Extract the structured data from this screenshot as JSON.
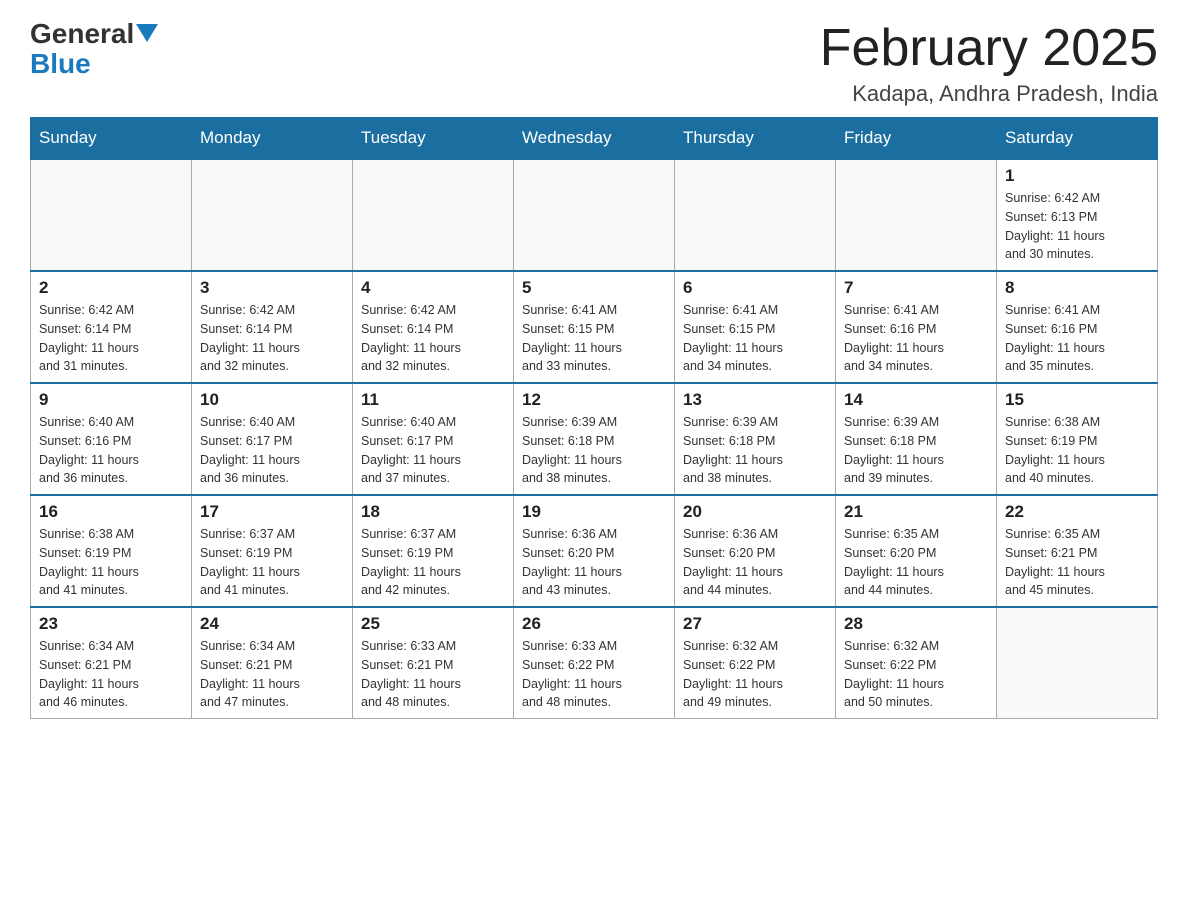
{
  "logo": {
    "general": "General",
    "blue": "Blue"
  },
  "header": {
    "title": "February 2025",
    "location": "Kadapa, Andhra Pradesh, India"
  },
  "days_of_week": [
    "Sunday",
    "Monday",
    "Tuesday",
    "Wednesday",
    "Thursday",
    "Friday",
    "Saturday"
  ],
  "weeks": [
    [
      {
        "date": "",
        "info": ""
      },
      {
        "date": "",
        "info": ""
      },
      {
        "date": "",
        "info": ""
      },
      {
        "date": "",
        "info": ""
      },
      {
        "date": "",
        "info": ""
      },
      {
        "date": "",
        "info": ""
      },
      {
        "date": "1",
        "info": "Sunrise: 6:42 AM\nSunset: 6:13 PM\nDaylight: 11 hours\nand 30 minutes."
      }
    ],
    [
      {
        "date": "2",
        "info": "Sunrise: 6:42 AM\nSunset: 6:14 PM\nDaylight: 11 hours\nand 31 minutes."
      },
      {
        "date": "3",
        "info": "Sunrise: 6:42 AM\nSunset: 6:14 PM\nDaylight: 11 hours\nand 32 minutes."
      },
      {
        "date": "4",
        "info": "Sunrise: 6:42 AM\nSunset: 6:14 PM\nDaylight: 11 hours\nand 32 minutes."
      },
      {
        "date": "5",
        "info": "Sunrise: 6:41 AM\nSunset: 6:15 PM\nDaylight: 11 hours\nand 33 minutes."
      },
      {
        "date": "6",
        "info": "Sunrise: 6:41 AM\nSunset: 6:15 PM\nDaylight: 11 hours\nand 34 minutes."
      },
      {
        "date": "7",
        "info": "Sunrise: 6:41 AM\nSunset: 6:16 PM\nDaylight: 11 hours\nand 34 minutes."
      },
      {
        "date": "8",
        "info": "Sunrise: 6:41 AM\nSunset: 6:16 PM\nDaylight: 11 hours\nand 35 minutes."
      }
    ],
    [
      {
        "date": "9",
        "info": "Sunrise: 6:40 AM\nSunset: 6:16 PM\nDaylight: 11 hours\nand 36 minutes."
      },
      {
        "date": "10",
        "info": "Sunrise: 6:40 AM\nSunset: 6:17 PM\nDaylight: 11 hours\nand 36 minutes."
      },
      {
        "date": "11",
        "info": "Sunrise: 6:40 AM\nSunset: 6:17 PM\nDaylight: 11 hours\nand 37 minutes."
      },
      {
        "date": "12",
        "info": "Sunrise: 6:39 AM\nSunset: 6:18 PM\nDaylight: 11 hours\nand 38 minutes."
      },
      {
        "date": "13",
        "info": "Sunrise: 6:39 AM\nSunset: 6:18 PM\nDaylight: 11 hours\nand 38 minutes."
      },
      {
        "date": "14",
        "info": "Sunrise: 6:39 AM\nSunset: 6:18 PM\nDaylight: 11 hours\nand 39 minutes."
      },
      {
        "date": "15",
        "info": "Sunrise: 6:38 AM\nSunset: 6:19 PM\nDaylight: 11 hours\nand 40 minutes."
      }
    ],
    [
      {
        "date": "16",
        "info": "Sunrise: 6:38 AM\nSunset: 6:19 PM\nDaylight: 11 hours\nand 41 minutes."
      },
      {
        "date": "17",
        "info": "Sunrise: 6:37 AM\nSunset: 6:19 PM\nDaylight: 11 hours\nand 41 minutes."
      },
      {
        "date": "18",
        "info": "Sunrise: 6:37 AM\nSunset: 6:19 PM\nDaylight: 11 hours\nand 42 minutes."
      },
      {
        "date": "19",
        "info": "Sunrise: 6:36 AM\nSunset: 6:20 PM\nDaylight: 11 hours\nand 43 minutes."
      },
      {
        "date": "20",
        "info": "Sunrise: 6:36 AM\nSunset: 6:20 PM\nDaylight: 11 hours\nand 44 minutes."
      },
      {
        "date": "21",
        "info": "Sunrise: 6:35 AM\nSunset: 6:20 PM\nDaylight: 11 hours\nand 44 minutes."
      },
      {
        "date": "22",
        "info": "Sunrise: 6:35 AM\nSunset: 6:21 PM\nDaylight: 11 hours\nand 45 minutes."
      }
    ],
    [
      {
        "date": "23",
        "info": "Sunrise: 6:34 AM\nSunset: 6:21 PM\nDaylight: 11 hours\nand 46 minutes."
      },
      {
        "date": "24",
        "info": "Sunrise: 6:34 AM\nSunset: 6:21 PM\nDaylight: 11 hours\nand 47 minutes."
      },
      {
        "date": "25",
        "info": "Sunrise: 6:33 AM\nSunset: 6:21 PM\nDaylight: 11 hours\nand 48 minutes."
      },
      {
        "date": "26",
        "info": "Sunrise: 6:33 AM\nSunset: 6:22 PM\nDaylight: 11 hours\nand 48 minutes."
      },
      {
        "date": "27",
        "info": "Sunrise: 6:32 AM\nSunset: 6:22 PM\nDaylight: 11 hours\nand 49 minutes."
      },
      {
        "date": "28",
        "info": "Sunrise: 6:32 AM\nSunset: 6:22 PM\nDaylight: 11 hours\nand 50 minutes."
      },
      {
        "date": "",
        "info": ""
      }
    ]
  ]
}
